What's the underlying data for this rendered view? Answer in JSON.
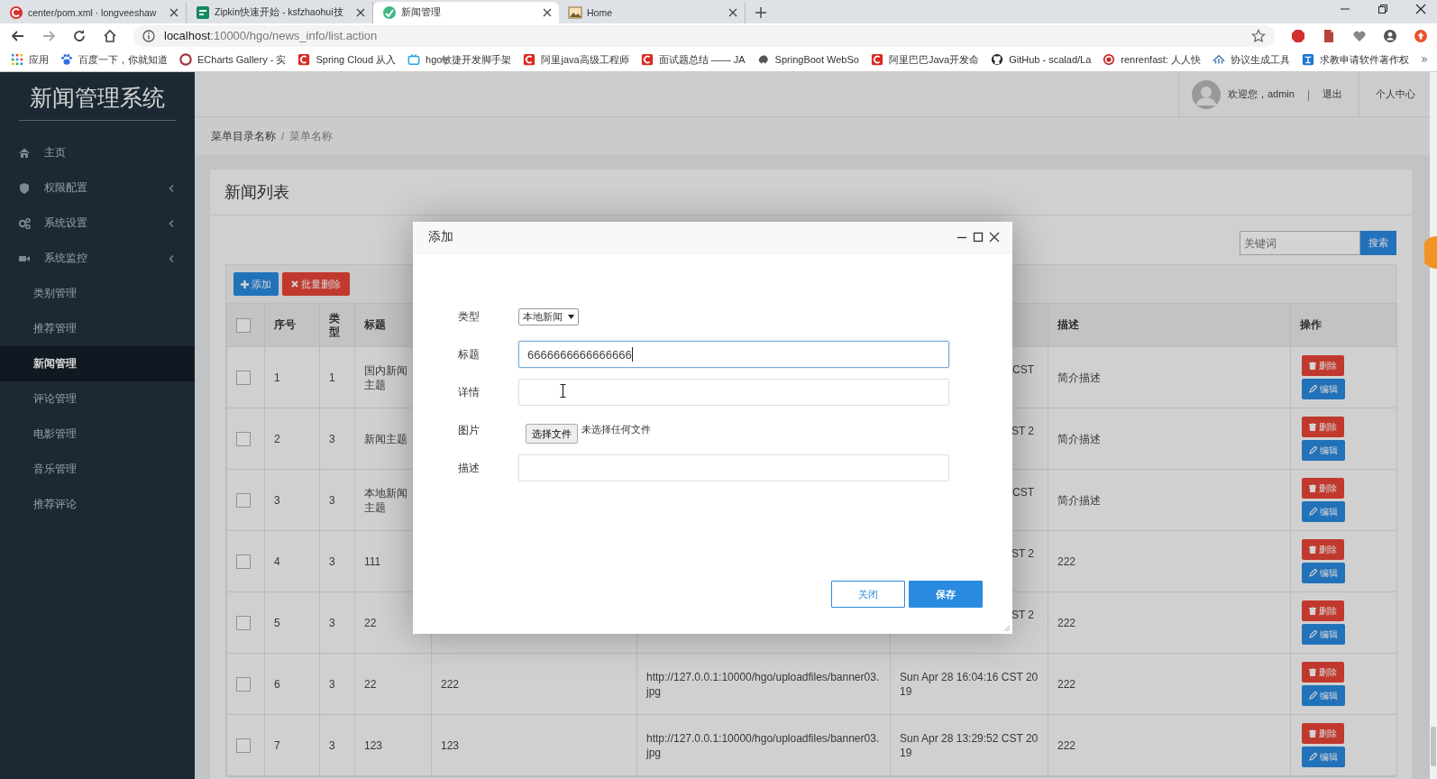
{
  "browser": {
    "tabs": [
      {
        "title": "center/pom.xml · longveeshaw",
        "selected": false
      },
      {
        "title": "Zipkin快速开始 - ksfzhaohui技",
        "selected": false
      },
      {
        "title": "新闻管理",
        "selected": true
      },
      {
        "title": "Home",
        "selected": false
      }
    ],
    "address": {
      "host": "localhost",
      "path": ":10000/hgo/news_info/list.action"
    },
    "bookmarks": [
      "应用",
      "百度一下，你就知道",
      "ECharts Gallery - 实",
      "Spring Cloud 从入",
      "hgo敏捷开发脚手架",
      "阿里java高级工程师",
      "面试题总结 —— JA",
      "SpringBoot WebSo",
      "阿里巴巴Java开发命",
      "GitHub - scalad/La",
      "renrenfast: 人人快",
      "协议生成工具",
      "求教申请软件著作权"
    ]
  },
  "sidebar": {
    "brand": "新闻管理系统",
    "items": [
      {
        "label": "主页",
        "kind": "main",
        "selected": false
      },
      {
        "label": "权限配置",
        "kind": "group",
        "expanded": false,
        "selected": false
      },
      {
        "label": "系统设置",
        "kind": "group",
        "expanded": false,
        "selected": false
      },
      {
        "label": "系统监控",
        "kind": "group",
        "expanded": false,
        "selected": false
      },
      {
        "label": "类别管理",
        "kind": "link",
        "selected": false
      },
      {
        "label": "推荐管理",
        "kind": "link",
        "selected": false
      },
      {
        "label": "新闻管理",
        "kind": "link",
        "selected": true
      },
      {
        "label": "评论管理",
        "kind": "link",
        "selected": false
      },
      {
        "label": "电影管理",
        "kind": "link",
        "selected": false
      },
      {
        "label": "音乐管理",
        "kind": "link",
        "selected": false
      },
      {
        "label": "推荐评论",
        "kind": "link",
        "selected": false
      }
    ]
  },
  "header": {
    "welcome": "欢迎您，admin",
    "separator": "|",
    "logout": "退出",
    "profile": "个人中心"
  },
  "breadcrumb": {
    "items": [
      "菜单目录名称",
      "菜单名称"
    ],
    "separator": "/"
  },
  "card": {
    "title": "新闻列表",
    "search": {
      "placeholder": "关键词",
      "button": "搜索"
    },
    "toolbar": [
      {
        "label": "添加",
        "kind": "primary"
      },
      {
        "label": "批量删除",
        "kind": "danger"
      }
    ],
    "table": {
      "all_checked": false,
      "columns": [
        "序号",
        "类型",
        "标题",
        null,
        null,
        null,
        "描述",
        "操作"
      ],
      "rows": [
        {
          "checked": false,
          "cells": [
            "1",
            "1",
            "国内新闻主题",
            null,
            null,
            {
              "text": "CST",
              "cut": true
            },
            "简介描述"
          ],
          "actions": [
            "删除",
            "编辑"
          ]
        },
        {
          "checked": false,
          "cells": [
            "2",
            "3",
            "新闻主题",
            null,
            null,
            {
              "text": "ST 2",
              "cut": true
            },
            "简介描述"
          ],
          "actions": [
            "删除",
            "编辑"
          ]
        },
        {
          "checked": false,
          "cells": [
            "3",
            "3",
            "本地新闻主题",
            null,
            null,
            {
              "text": "CST",
              "cut": true
            },
            "简介描述"
          ],
          "actions": [
            "删除",
            "编辑"
          ]
        },
        {
          "checked": false,
          "cells": [
            "4",
            "3",
            "111",
            null,
            null,
            {
              "text": "ST 2",
              "cut": true
            },
            "222"
          ],
          "actions": [
            "删除",
            "编辑"
          ]
        },
        {
          "checked": false,
          "cells": [
            "5",
            "3",
            "22",
            null,
            null,
            {
              "text": "ST 2",
              "cut": true
            },
            "222"
          ],
          "actions": [
            "删除",
            "编辑"
          ]
        },
        {
          "checked": false,
          "cells": [
            "6",
            "3",
            "22",
            "222",
            "http://127.0.0.1:10000/hgo/uploadfiles/banner03.jpg",
            "Sun Apr 28 16:04:16 CST 2019",
            "222"
          ],
          "actions": [
            "删除",
            "编辑"
          ]
        },
        {
          "checked": false,
          "cells": [
            "7",
            "3",
            "123",
            "123",
            "http://127.0.0.1:10000/hgo/uploadfiles/banner03.jpg",
            "Sun Apr 28 13:29:52 CST 2019",
            "222"
          ],
          "actions": [
            "删除",
            "编辑"
          ]
        }
      ]
    }
  },
  "dialog": {
    "title": "添加",
    "fields": [
      {
        "label": "类型",
        "kind": "select",
        "value": "本地新闻"
      },
      {
        "label": "标题",
        "kind": "text",
        "value": "6666666666666666",
        "focused": true
      },
      {
        "label": "详情",
        "kind": "text",
        "focused": false
      },
      {
        "label": "图片",
        "kind": "file",
        "button": "选择文件",
        "status": "未选择任何文件"
      },
      {
        "label": "描述",
        "kind": "text",
        "focused": false
      }
    ],
    "buttons": [
      {
        "label": "关闭",
        "kind": "secondary"
      },
      {
        "label": "保存",
        "kind": "primary"
      }
    ]
  }
}
